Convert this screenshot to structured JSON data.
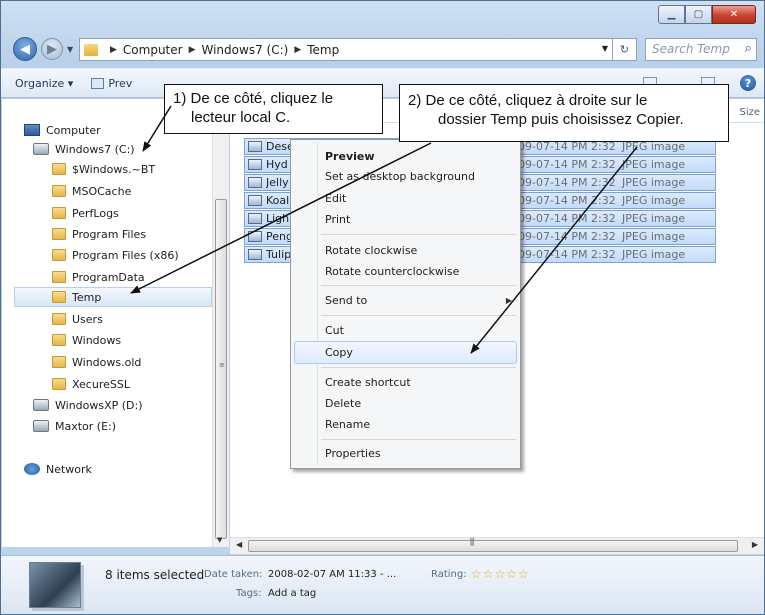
{
  "window": {
    "controls": {
      "minimize": "▁",
      "maximize": "▢",
      "close": "✕"
    }
  },
  "address": {
    "crumbs": [
      "Computer",
      "Windows7 (C:)",
      "Temp"
    ],
    "search_placeholder": "Search Temp"
  },
  "toolbar": {
    "organize": "Organize ▾",
    "preview": "Prev"
  },
  "nav": {
    "items": [
      {
        "label": "Computer",
        "icon": "computer-icon"
      },
      {
        "label": "Windows7 (C:)",
        "icon": "drive-icon"
      },
      {
        "label": "$Windows.~BT",
        "icon": "folder-icon"
      },
      {
        "label": "MSOCache",
        "icon": "folder-icon"
      },
      {
        "label": "PerfLogs",
        "icon": "folder-icon"
      },
      {
        "label": "Program Files",
        "icon": "folder-icon"
      },
      {
        "label": "Program Files (x86)",
        "icon": "folder-icon"
      },
      {
        "label": "ProgramData",
        "icon": "folder-icon"
      },
      {
        "label": "Temp",
        "icon": "folder-icon",
        "selected": true
      },
      {
        "label": "Users",
        "icon": "folder-icon"
      },
      {
        "label": "Windows",
        "icon": "folder-icon"
      },
      {
        "label": "Windows.old",
        "icon": "folder-icon"
      },
      {
        "label": "XecureSSL",
        "icon": "folder-icon"
      },
      {
        "label": "WindowsXP (D:)",
        "icon": "drive-icon"
      },
      {
        "label": "Maxtor (E:)",
        "icon": "drive-icon"
      },
      {
        "label": "Network",
        "icon": "network-icon"
      }
    ]
  },
  "content": {
    "size_header": "Size",
    "files": [
      {
        "name": "Dese",
        "date": "09-07-14 PM 2:32",
        "type": "JPEG image"
      },
      {
        "name": "Hyd",
        "date": "09-07-14 PM 2:32",
        "type": "JPEG image"
      },
      {
        "name": "Jelly",
        "date": "09-07-14 PM 2:32",
        "type": "JPEG image"
      },
      {
        "name": "Koal",
        "date": "09-07-14 PM 2:32",
        "type": "JPEG image"
      },
      {
        "name": "Ligh",
        "date": "09-07-14 PM 2:32",
        "type": "JPEG image"
      },
      {
        "name": "Peng",
        "date": "09-07-14 PM 2:32",
        "type": "JPEG image"
      },
      {
        "name": "Tulip",
        "date": "09-07-14 PM 2:32",
        "type": "JPEG image"
      }
    ]
  },
  "context_menu": {
    "preview": "Preview",
    "set_background": "Set as desktop background",
    "edit": "Edit",
    "print": "Print",
    "rotate_cw": "Rotate clockwise",
    "rotate_ccw": "Rotate counterclockwise",
    "send_to": "Send to",
    "cut": "Cut",
    "copy": "Copy",
    "create_shortcut": "Create shortcut",
    "delete": "Delete",
    "rename": "Rename",
    "properties": "Properties"
  },
  "details": {
    "selected_count": "8 items selected",
    "date_label": "Date taken:",
    "date_value": "2008-02-07 AM 11:33 - ...",
    "tags_label": "Tags:",
    "tags_value": "Add a tag",
    "rating_label": "Rating:",
    "rating_stars": "☆☆☆☆☆",
    "rating_value": 0
  },
  "callouts": {
    "one_line1": "1) De ce côté, cliquez le",
    "one_line2": "lecteur local C.",
    "two_line1": "2) De ce côté, cliquez à droite sur le",
    "two_line2": "dossier Temp puis choisissez Copier."
  },
  "colors": {
    "selection": "#c1dcfc",
    "menu_highlight": "#deecfc",
    "close_button": "#c7432e"
  }
}
